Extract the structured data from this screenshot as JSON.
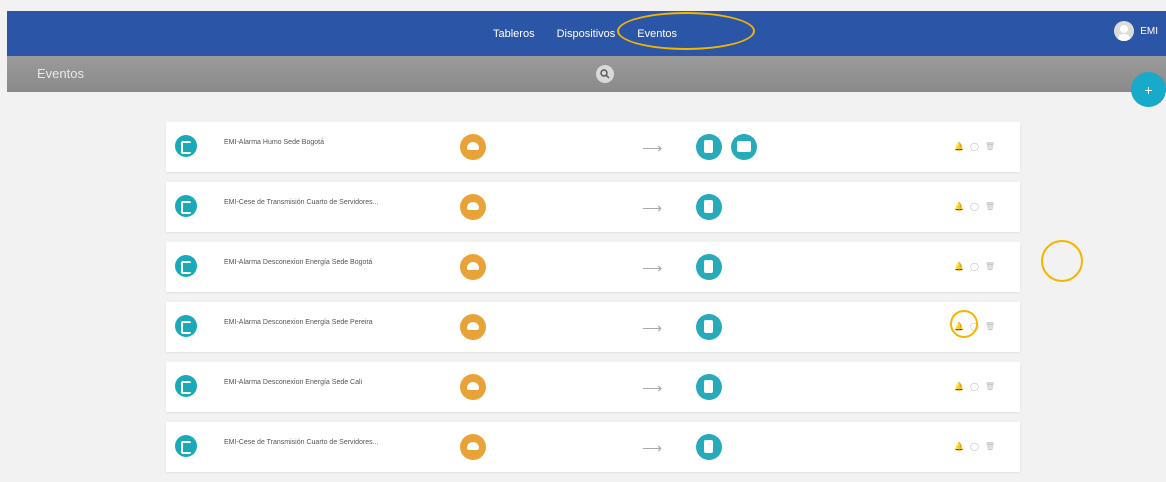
{
  "header": {
    "nav": [
      "Tableros",
      "Dispositivos",
      "Eventos"
    ],
    "user": "EMI"
  },
  "subheader": {
    "title": "Eventos"
  },
  "fab": {
    "label": "+"
  },
  "events": [
    {
      "name": "EMI-Alarma Humo Sede Bogotá",
      "actions": [
        "email",
        "sms"
      ]
    },
    {
      "name": "EMI-Cese de Transmisión Cuarto de Servidores...",
      "actions": [
        "email"
      ]
    },
    {
      "name": "EMI-Alarma Desconexion Energía Sede Bogotá",
      "actions": [
        "email"
      ]
    },
    {
      "name": "EMI-Alarma Desconexion Energía Sede Pereira",
      "actions": [
        "email"
      ]
    },
    {
      "name": "EMI-Alarma Desconexion Energía Sede Cali",
      "actions": [
        "email"
      ]
    },
    {
      "name": "EMI-Cese de Transmisión Cuarto de Servidores...",
      "actions": [
        "email"
      ]
    }
  ],
  "colors": {
    "topbar": "#2b55a7",
    "subbar": "#8f8f8f",
    "calendar_icon": "#19a9b8",
    "trigger_icon": "#e9a238",
    "action_icon": "#27aab9",
    "highlight": "#f5b400"
  }
}
